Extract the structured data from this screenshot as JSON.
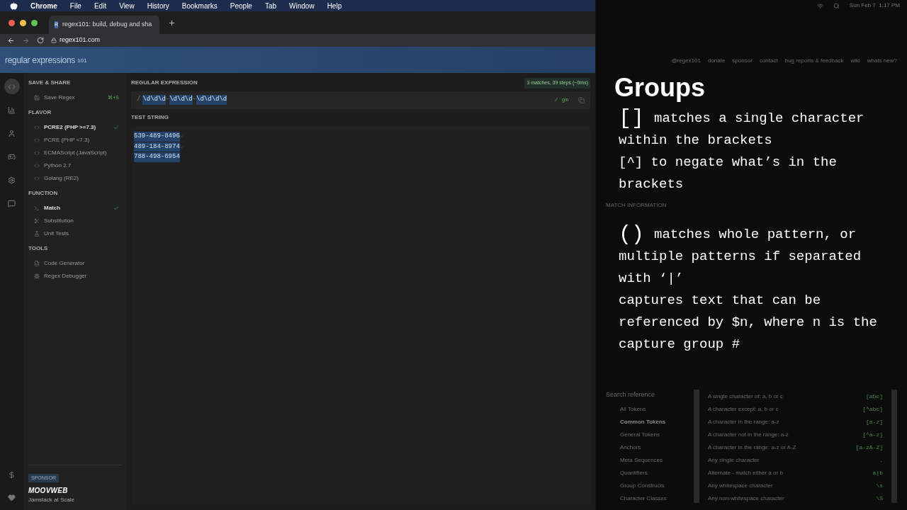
{
  "menubar": {
    "app": "Chrome",
    "menus": [
      "File",
      "Edit",
      "View",
      "History",
      "Bookmarks",
      "People",
      "Tab",
      "Window",
      "Help"
    ],
    "clock": "Sun Feb 7  1:17 PM"
  },
  "browser": {
    "tab": {
      "favicon": "R",
      "title": "regex101: build, debug and sha"
    },
    "url": "regex101.com"
  },
  "site": {
    "logo": "regular expressions",
    "logo_suffix": "101",
    "links": [
      "@regex101",
      "donate",
      "sponsor",
      "contact",
      "bug reports & feedback",
      "wiki",
      "whats new?"
    ]
  },
  "sidebar": [
    {
      "title": "SAVE & SHARE",
      "items": [
        {
          "label": "Save Regex",
          "kind": "save",
          "selected": false,
          "shortcut": "⌘+S"
        }
      ]
    },
    {
      "title": "FLAVOR",
      "items": [
        {
          "label": "PCRE2 (PHP >=7.3)",
          "kind": "flavor",
          "selected": true
        },
        {
          "label": "PCRE (PHP <7.3)",
          "kind": "flavor",
          "selected": false
        },
        {
          "label": "ECMAScript (JavaScript)",
          "kind": "flavor",
          "selected": false
        },
        {
          "label": "Python 2.7",
          "kind": "flavor",
          "selected": false
        },
        {
          "label": "Golang (RE2)",
          "kind": "flavor",
          "selected": false
        }
      ]
    },
    {
      "title": "FUNCTION",
      "items": [
        {
          "label": "Match",
          "kind": "match",
          "selected": true
        },
        {
          "label": "Substitution",
          "kind": "substitution",
          "selected": false
        },
        {
          "label": "Unit Tests",
          "kind": "tests",
          "selected": false
        }
      ]
    },
    {
      "title": "TOOLS",
      "items": [
        {
          "label": "Code Generator",
          "kind": "generator",
          "selected": false
        },
        {
          "label": "Regex Debugger",
          "kind": "debugger",
          "selected": false
        }
      ]
    }
  ],
  "sponsor": {
    "label": "SPONSOR",
    "brand": "MOOVWEB",
    "tagline": "Jamstack at Scale"
  },
  "regex": {
    "label": "REGULAR EXPRESSION",
    "match_info": "3 matches, 39 steps (~0ms)",
    "delimiter": "/",
    "tokens": [
      {
        "text": "\\d\\d\\d",
        "highlighted": true
      },
      {
        "text": "-",
        "highlighted": false
      },
      {
        "text": "\\d\\d\\d",
        "highlighted": true
      },
      {
        "text": "-",
        "highlighted": false
      },
      {
        "text": "\\d\\d\\d\\d",
        "highlighted": true
      }
    ],
    "flags": "/ gm"
  },
  "test_string": {
    "label": "TEST STRING",
    "lines": [
      {
        "text": "539-489-8496",
        "highlighted": true,
        "newline": true
      },
      {
        "text": "489-184-8974",
        "highlighted": true,
        "newline": true
      },
      {
        "text": "788-498-6954",
        "highlighted": true,
        "newline": false
      }
    ]
  },
  "overlay": {
    "title": "Groups",
    "blocks": [
      {
        "symbol": "[]",
        "lines": [
          "matches a single character within the brackets",
          "[^] to negate what’s in the brackets"
        ]
      },
      {
        "symbol": "()",
        "lines": [
          "matches whole pattern, or multiple patterns if separated with ‘|’",
          "captures text that can be referenced by $n, where n is the capture group #"
        ]
      }
    ]
  },
  "match_information": {
    "label": "MATCH INFORMATION"
  },
  "quick_reference": {
    "placeholder": "Search reference",
    "categories": [
      {
        "label": "All Tokens",
        "selected": false
      },
      {
        "label": "Common Tokens",
        "selected": true
      },
      {
        "label": "General Tokens",
        "selected": false
      },
      {
        "label": "Anchors",
        "selected": false
      },
      {
        "label": "Meta Sequences",
        "selected": false
      },
      {
        "label": "Quantifiers",
        "selected": false
      },
      {
        "label": "Group Constructs",
        "selected": false
      },
      {
        "label": "Character Classes",
        "selected": false
      }
    ],
    "tokens": [
      {
        "description": "A single character of: a, b or c",
        "token": "[abc]"
      },
      {
        "description": "A character except: a, b or c",
        "token": "[^abc]"
      },
      {
        "description": "A character in the range: a-z",
        "token": "[a-z]"
      },
      {
        "description": "A character not in the range: a-z",
        "token": "[^a-z]"
      },
      {
        "description": "A character in the range: a-z or A-Z",
        "token": "[a-zA-Z]"
      },
      {
        "description": "Any single character",
        "token": "."
      },
      {
        "description": "Alternate - match either a or b",
        "token": "a|b"
      },
      {
        "description": "Any whitespace character",
        "token": "\\s"
      },
      {
        "description": "Any non-whitespace character",
        "token": "\\S"
      }
    ]
  }
}
